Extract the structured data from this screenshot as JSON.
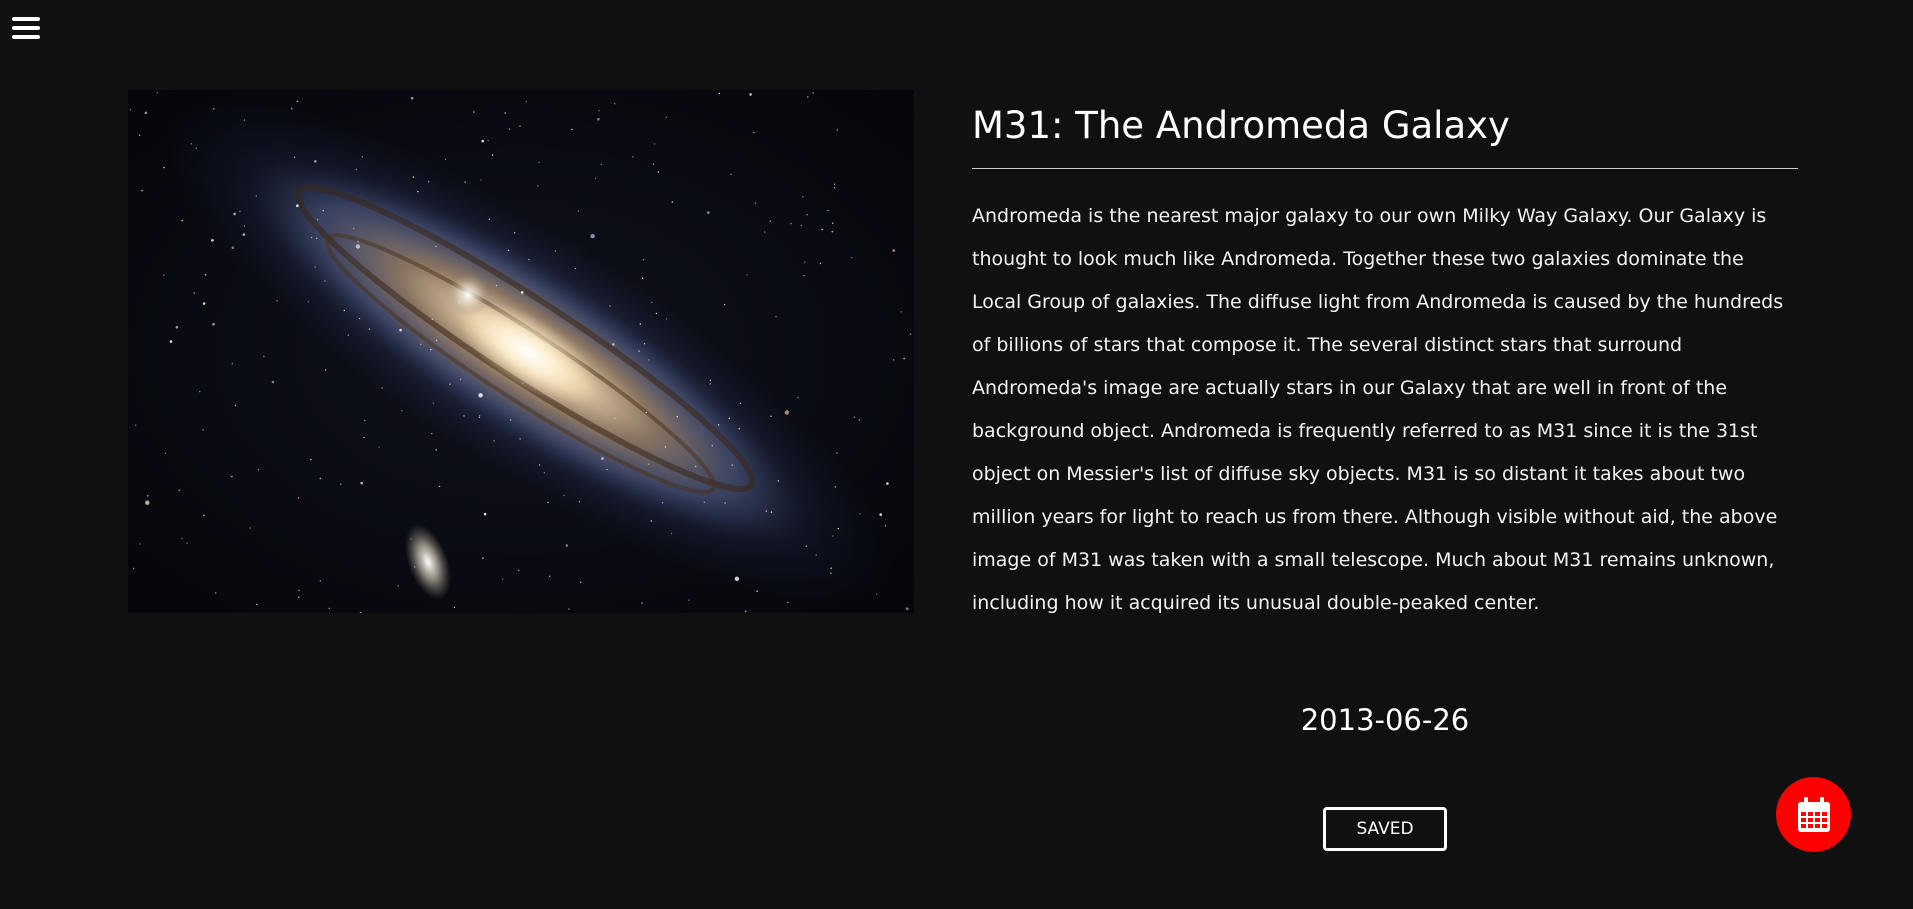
{
  "header": {
    "menu_icon": "hamburger-menu-icon"
  },
  "entry": {
    "image_alt": "M31: The Andromeda Galaxy",
    "title": "M31: The Andromeda Galaxy",
    "description": "Andromeda is the nearest major galaxy to our own Milky Way Galaxy. Our Galaxy is thought to look much like Andromeda. Together these two galaxies dominate the Local Group of galaxies. The diffuse light from Andromeda is caused by the hundreds of billions of stars that compose it. The several distinct stars that surround Andromeda's image are actually stars in our Galaxy that are well in front of the background object. Andromeda is frequently referred to as M31 since it is the 31st object on Messier's list of diffuse sky objects. M31 is so distant it takes about two million years for light to reach us from there. Although visible without aid, the above image of M31 was taken with a small telescope. Much about M31 remains unknown, including how it acquired its unusual double-peaked center.",
    "date": "2013-06-26",
    "saved_label": "SAVED"
  },
  "fab": {
    "icon": "calendar-icon",
    "color": "#ff0000"
  },
  "colors": {
    "background": "#101010",
    "text": "#ffffff"
  }
}
